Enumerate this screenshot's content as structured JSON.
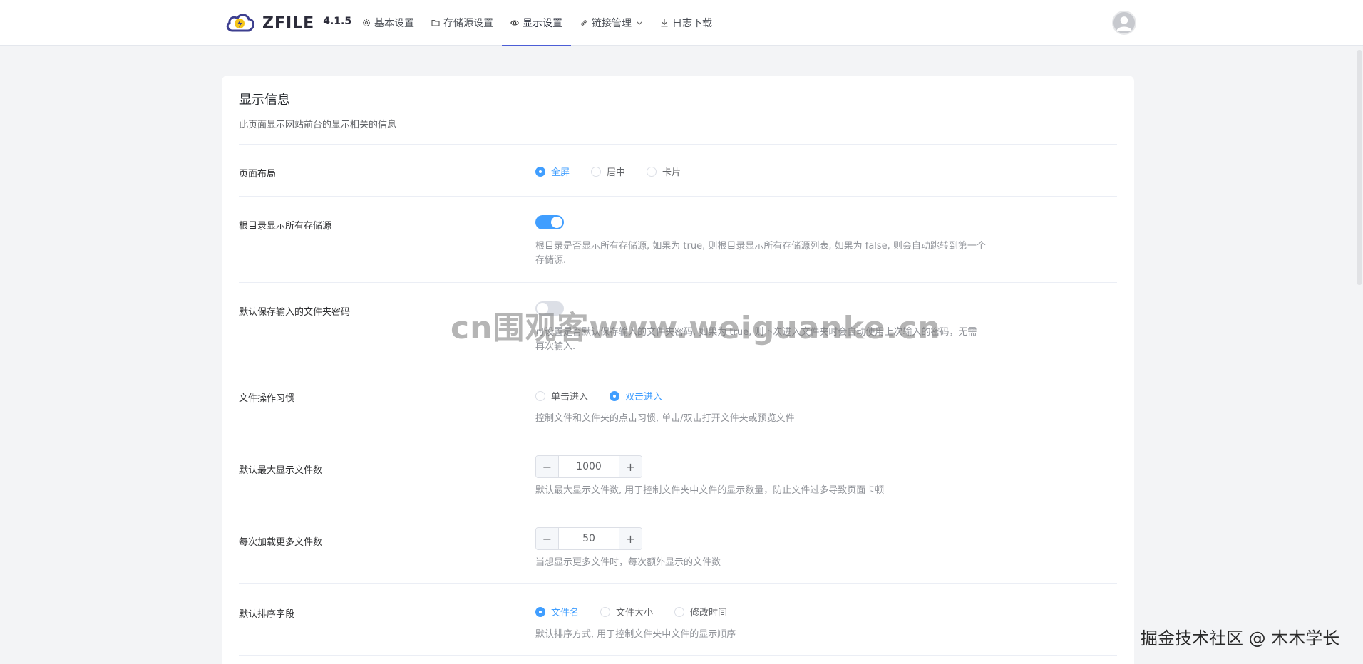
{
  "header": {
    "logo_text": "ZFILE",
    "version": "4.1.5",
    "nav": [
      {
        "label": "基本设置",
        "icon": "gear-icon"
      },
      {
        "label": "存储源设置",
        "icon": "folder-icon"
      },
      {
        "label": "显示设置",
        "icon": "eye-icon",
        "active": true
      },
      {
        "label": "链接管理",
        "icon": "link-icon",
        "dropdown": true
      },
      {
        "label": "日志下载",
        "icon": "download-icon"
      }
    ]
  },
  "card": {
    "title": "显示信息",
    "subtitle": "此页面显示网站前台的显示相关的信息"
  },
  "layout": {
    "label": "页面布局",
    "options": [
      "全屏",
      "居中",
      "卡片"
    ],
    "selected": "全屏"
  },
  "root_show_all": {
    "label": "根目录显示所有存储源",
    "enabled": true,
    "help_line1": "根目录是否显示所有存储源, 如果为 true, 则根目录显示所有存储源列表, 如果为 false, 则会自动跳转到第一个",
    "help_line2": "存储源."
  },
  "remember_password": {
    "label": "默认保存输入的文件夹密码",
    "enabled": false,
    "help_line1": "可设置是否默认保存输入的文件夹密码, 如果为 true, 则下次进入文件夹时会自动使用上次输入的密码，无需",
    "help_line2": "再次输入."
  },
  "click_habit": {
    "label": "文件操作习惯",
    "options": [
      "单击进入",
      "双击进入"
    ],
    "selected": "双击进入",
    "help": "控制文件和文件夹的点击习惯, 单击/双击打开文件夹或预览文件"
  },
  "max_files": {
    "label": "默认最大显示文件数",
    "value": "1000",
    "help": "默认最大显示文件数, 用于控制文件夹中文件的显示数量，防止文件过多导致页面卡顿"
  },
  "load_more": {
    "label": "每次加载更多文件数",
    "value": "50",
    "help": "当想显示更多文件时，每次额外显示的文件数"
  },
  "sort_field": {
    "label": "默认排序字段",
    "options": [
      "文件名",
      "文件大小",
      "修改时间"
    ],
    "selected": "文件名",
    "help": "默认排序方式, 用于控制文件夹中文件的显示顺序"
  },
  "watermarks": {
    "center": "cn围观客www.weiguanke.cn",
    "corner": "掘金技术社区 @ 木木学长"
  },
  "colors": {
    "primary": "#409eff",
    "nav_active": "#4b5dd6",
    "background": "#f3f4f6"
  }
}
